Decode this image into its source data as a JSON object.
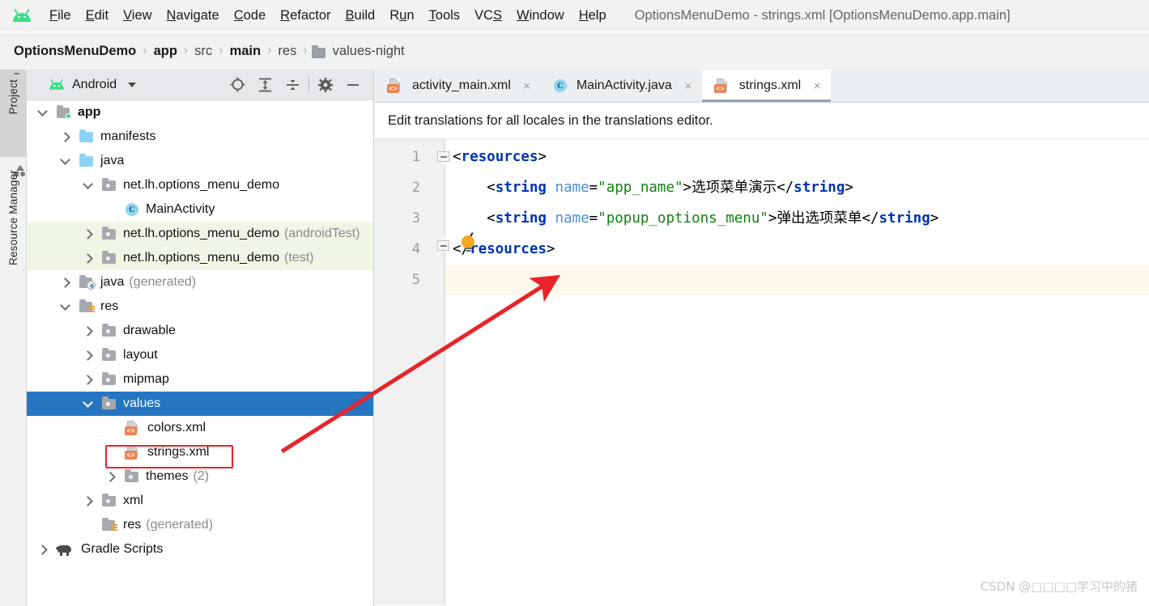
{
  "window": {
    "title": "OptionsMenuDemo - strings.xml [OptionsMenuDemo.app.main]"
  },
  "menubar": {
    "items": [
      {
        "label": "File",
        "mnemonic": "F"
      },
      {
        "label": "Edit",
        "mnemonic": "E"
      },
      {
        "label": "View",
        "mnemonic": "V"
      },
      {
        "label": "Navigate",
        "mnemonic": "N"
      },
      {
        "label": "Code",
        "mnemonic": "C"
      },
      {
        "label": "Refactor",
        "mnemonic": "R"
      },
      {
        "label": "Build",
        "mnemonic": "B"
      },
      {
        "label": "Run",
        "mnemonic": "u"
      },
      {
        "label": "Tools",
        "mnemonic": "T"
      },
      {
        "label": "VCS",
        "mnemonic": "S"
      },
      {
        "label": "Window",
        "mnemonic": "W"
      },
      {
        "label": "Help",
        "mnemonic": "H"
      }
    ],
    "logo_icon": "android-logo-icon"
  },
  "breadcrumb": {
    "items": [
      {
        "label": "OptionsMenuDemo",
        "bold": true,
        "icon": ""
      },
      {
        "label": "app",
        "bold": true,
        "icon": ""
      },
      {
        "label": "src",
        "bold": false,
        "icon": ""
      },
      {
        "label": "main",
        "bold": true,
        "icon": ""
      },
      {
        "label": "res",
        "bold": false,
        "icon": ""
      },
      {
        "label": "values-night",
        "bold": false,
        "icon": "folder-icon"
      }
    ],
    "separator": "›"
  },
  "rail": {
    "items": [
      {
        "label": "Project",
        "icon": "folder-icon",
        "selected": true
      },
      {
        "label": "Resource Manager",
        "icon": "shapes-icon",
        "selected": false
      }
    ]
  },
  "project_panel": {
    "title": "Android",
    "dropdown_icon": "chevron-down-icon",
    "tools": [
      {
        "name": "select-opened-file-icon",
        "title": "Select Opened File"
      },
      {
        "name": "expand-all-icon",
        "title": "Expand All"
      },
      {
        "name": "collapse-all-icon",
        "title": "Collapse All"
      },
      {
        "name": "settings-gear-icon",
        "title": "Settings"
      },
      {
        "name": "hide-panel-icon",
        "title": "Hide"
      }
    ],
    "tree": [
      {
        "label": "app",
        "suffix": "",
        "indent": 0,
        "arrow": "down",
        "icon": "module-folder",
        "bold": true,
        "state": "normal"
      },
      {
        "label": "manifests",
        "suffix": "",
        "indent": 1,
        "arrow": "right",
        "icon": "folder-blue",
        "bold": false,
        "state": "normal"
      },
      {
        "label": "java",
        "suffix": "",
        "indent": 1,
        "arrow": "down",
        "icon": "folder-blue",
        "bold": false,
        "state": "normal"
      },
      {
        "label": "net.lh.options_menu_demo",
        "suffix": "",
        "indent": 2,
        "arrow": "down",
        "icon": "folder-package",
        "bold": false,
        "state": "normal"
      },
      {
        "label": "MainActivity",
        "suffix": "",
        "indent": 3,
        "arrow": "none",
        "icon": "class-icon",
        "bold": false,
        "state": "normal"
      },
      {
        "label": "net.lh.options_menu_demo",
        "suffix": "(androidTest)",
        "indent": 2,
        "arrow": "right",
        "icon": "folder-package",
        "bold": false,
        "state": "green"
      },
      {
        "label": "net.lh.options_menu_demo",
        "suffix": "(test)",
        "indent": 2,
        "arrow": "right",
        "icon": "folder-package",
        "bold": false,
        "state": "green"
      },
      {
        "label": "java",
        "suffix": "(generated)",
        "indent": 1,
        "arrow": "right",
        "icon": "folder-generated",
        "bold": false,
        "state": "normal"
      },
      {
        "label": "res",
        "suffix": "",
        "indent": 1,
        "arrow": "down",
        "icon": "folder-res",
        "bold": false,
        "state": "normal"
      },
      {
        "label": "drawable",
        "suffix": "",
        "indent": 2,
        "arrow": "right",
        "icon": "folder-package",
        "bold": false,
        "state": "normal"
      },
      {
        "label": "layout",
        "suffix": "",
        "indent": 2,
        "arrow": "right",
        "icon": "folder-package",
        "bold": false,
        "state": "normal"
      },
      {
        "label": "mipmap",
        "suffix": "",
        "indent": 2,
        "arrow": "right",
        "icon": "folder-package",
        "bold": false,
        "state": "normal"
      },
      {
        "label": "values",
        "suffix": "",
        "indent": 2,
        "arrow": "down",
        "icon": "folder-package",
        "bold": false,
        "state": "selected"
      },
      {
        "label": "colors.xml",
        "suffix": "",
        "indent": 3,
        "arrow": "none",
        "icon": "xml-file-icon",
        "bold": false,
        "state": "normal"
      },
      {
        "label": "strings.xml",
        "suffix": "",
        "indent": 3,
        "arrow": "none",
        "icon": "xml-file-icon",
        "bold": false,
        "state": "boxed"
      },
      {
        "label": "themes",
        "suffix": "(2)",
        "indent": 3,
        "arrow": "right",
        "icon": "folder-package",
        "bold": false,
        "state": "normal"
      },
      {
        "label": "xml",
        "suffix": "",
        "indent": 2,
        "arrow": "right",
        "icon": "folder-package",
        "bold": false,
        "state": "normal"
      },
      {
        "label": "res",
        "suffix": "(generated)",
        "indent": 2,
        "arrow": "none",
        "icon": "folder-res",
        "bold": false,
        "state": "normal"
      },
      {
        "label": "Gradle Scripts",
        "suffix": "",
        "indent": 0,
        "arrow": "right",
        "icon": "gradle-icon",
        "bold": false,
        "state": "normal"
      }
    ]
  },
  "editor": {
    "tabs": [
      {
        "label": "activity_main.xml",
        "icon": "xml-file-icon",
        "active": false,
        "close": "×"
      },
      {
        "label": "MainActivity.java",
        "icon": "class-icon",
        "active": false,
        "close": "×"
      },
      {
        "label": "strings.xml",
        "icon": "xml-file-icon",
        "active": true,
        "close": "×"
      }
    ],
    "banner": "Edit translations for all locales in the translations editor.",
    "line_numbers": [
      "1",
      "2",
      "3",
      "4",
      "5"
    ],
    "code_lines": [
      {
        "n": "1",
        "indent": 0,
        "tokens": [
          {
            "t": "<",
            "c": "br"
          },
          {
            "t": "resources",
            "c": "tag"
          },
          {
            "t": ">",
            "c": "br"
          }
        ]
      },
      {
        "n": "2",
        "indent": 4,
        "tokens": [
          {
            "t": "<",
            "c": "br"
          },
          {
            "t": "string",
            "c": "tag"
          },
          {
            "t": " ",
            "c": "br"
          },
          {
            "t": "name",
            "c": "attr"
          },
          {
            "t": "=",
            "c": "br"
          },
          {
            "t": "\"app_name\"",
            "c": "val"
          },
          {
            "t": ">",
            "c": "br"
          },
          {
            "t": "选项菜单演示",
            "c": "txt"
          },
          {
            "t": "</",
            "c": "br"
          },
          {
            "t": "string",
            "c": "tag"
          },
          {
            "t": ">",
            "c": "br"
          }
        ]
      },
      {
        "n": "3",
        "indent": 4,
        "tokens": [
          {
            "t": "<",
            "c": "br"
          },
          {
            "t": "string",
            "c": "tag"
          },
          {
            "t": " ",
            "c": "br"
          },
          {
            "t": "name",
            "c": "attr"
          },
          {
            "t": "=",
            "c": "br"
          },
          {
            "t": "\"popup_options_menu\"",
            "c": "val"
          },
          {
            "t": ">",
            "c": "br"
          },
          {
            "t": "弹出选项菜单",
            "c": "txt"
          },
          {
            "t": "</",
            "c": "br"
          },
          {
            "t": "string",
            "c": "tag"
          },
          {
            "t": ">",
            "c": "br"
          }
        ]
      },
      {
        "n": "4",
        "indent": 0,
        "tokens": [
          {
            "t": "</",
            "c": "br"
          },
          {
            "t": "resources",
            "c": "tag"
          },
          {
            "t": ">",
            "c": "br"
          }
        ]
      },
      {
        "n": "5",
        "indent": 0,
        "tokens": []
      }
    ],
    "intention_icon": "lightbulb-icon",
    "caret_line": "5"
  },
  "annotation": {
    "arrow_color": "#e8242a",
    "box_color": "#e8242a"
  },
  "watermark": "CSDN @□□□□学习中的猪",
  "colors": {
    "selection_blue": "#2575c0",
    "test_green": "#eff6e6",
    "caret_cream": "#fcf9ec",
    "accent_orange": "#ef8354",
    "android_green": "#3ddc84"
  }
}
